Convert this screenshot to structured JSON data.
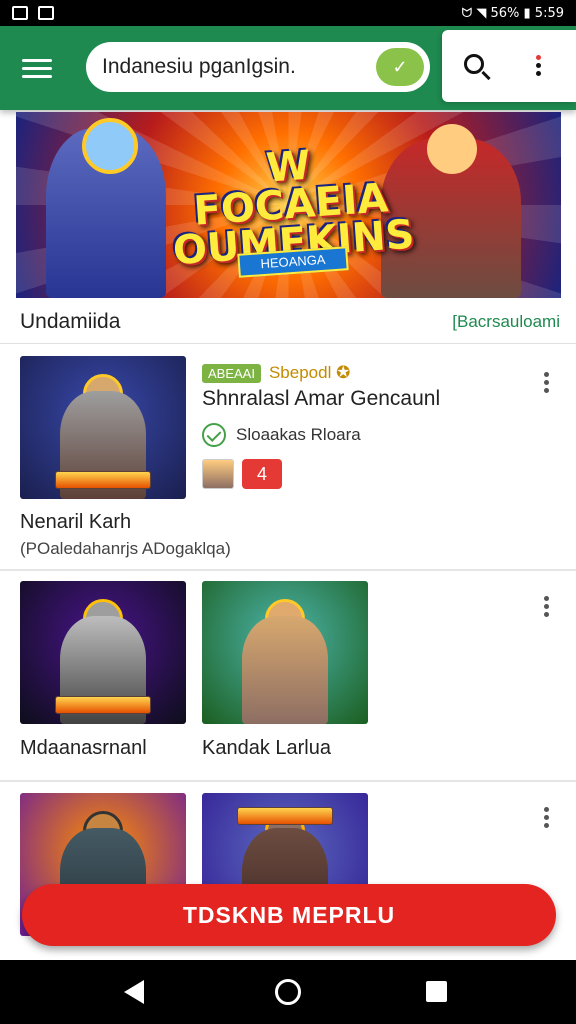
{
  "status_bar": {
    "right_text": "ᗢ ◥ 56% ▮ 5:59"
  },
  "app_bar": {
    "search_value": "Indanesiu pganIgsin.",
    "colors": {
      "primary": "#1e8a4f",
      "accent_green": "#8bc34a",
      "notification": "#e53935"
    }
  },
  "banner": {
    "title_line1": "W",
    "title_line2": "FOCAEIA",
    "title_line3": "OUMEKINS",
    "subtitle": "HEOANGA",
    "label": "Undamiida",
    "link": "[Bacrsauloami"
  },
  "cards": [
    {
      "badge": "ABEAAI",
      "badge_sub": "Sbepodl ✪",
      "title": "Shnralasl Amar Gencaunl",
      "meta": "Sloaakas Rloara",
      "mini_icon_text": "4",
      "caption": "Nenaril Karh",
      "caption_sub": "(POaledahanrjs ADogaklqa)"
    },
    {
      "left_caption": "Mdaanasrnanl",
      "right_caption": "Kandak Larlua"
    }
  ],
  "cta": {
    "label": "TDSKNB MEPRLU",
    "color": "#e32421"
  }
}
